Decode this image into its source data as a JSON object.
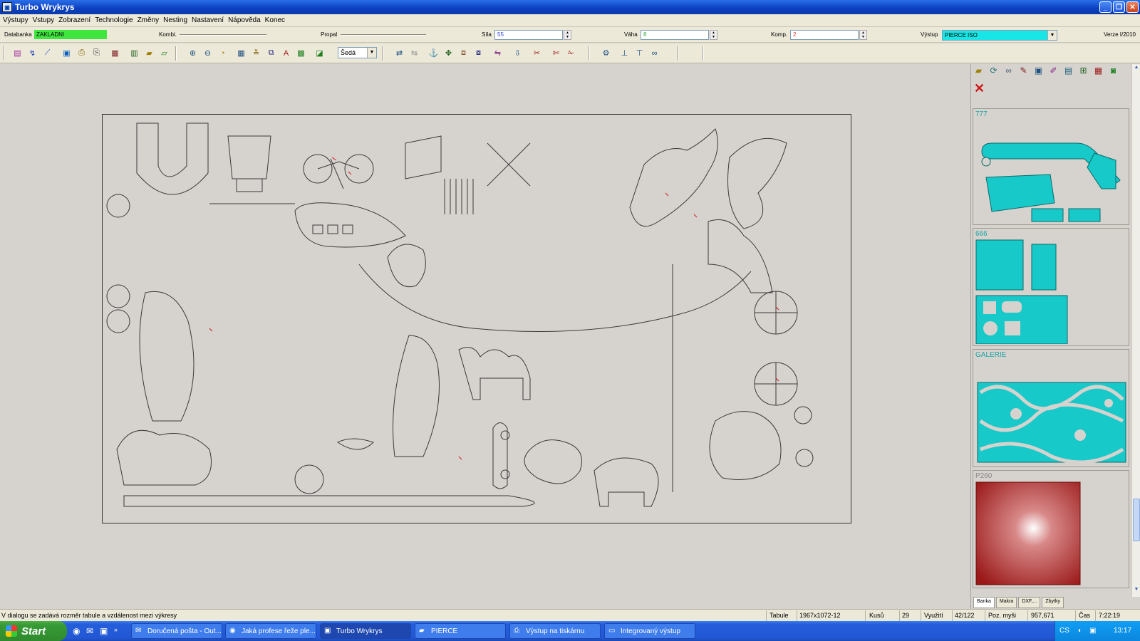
{
  "window": {
    "title": "Turbo Wrykrys"
  },
  "menu": [
    "Výstupy",
    "Vstupy",
    "Zobrazení",
    "Technologie",
    "Změny",
    "Nesting",
    "Nastavení",
    "Nápověda",
    "Konec"
  ],
  "params": {
    "databanka_label": "Databanka",
    "databanka_value": "ZAKLADNI",
    "kombi_label": "Kombi.",
    "propal_label": "Propal",
    "sila_label": "Síla",
    "sila_value": "55",
    "vaha_label": "Váha",
    "vaha_value": "8",
    "komp_label": "Komp.",
    "komp_value": "2",
    "vystup_label": "Výstup",
    "vystup_value": "PIERCE ISO",
    "verze": "Verze I/2010"
  },
  "toolbar": {
    "color_combo": "Šedá"
  },
  "panel": {
    "cards": [
      {
        "title": "777"
      },
      {
        "title": "666"
      },
      {
        "title": "GALERIE"
      },
      {
        "title": "P260"
      }
    ],
    "tabs": [
      "Banka",
      "Makra",
      "DXF,...",
      "Zbytky"
    ]
  },
  "status": {
    "hint": "V dialogu se zadává rozměr tabule a vzdálenost mezi výkresy",
    "tabule_label": "Tabule",
    "tabule_value": "1967x1072-12",
    "kusu_label": "Kusů",
    "kusu_value": "29",
    "vyuziti_label": "Využití",
    "vyuziti_value": "42/122",
    "pozmysi_label": "Poz. myši",
    "pozmysi_value": "957,671",
    "cas_label": "Čas",
    "cas_value": "7:22:19"
  },
  "taskbar": {
    "start": "Start",
    "tasks": [
      {
        "label": "Doručená pošta - Out..."
      },
      {
        "label": "Jaká profese řeže ple..."
      },
      {
        "label": "Turbo Wrykrys"
      },
      {
        "label": "PIERCE"
      },
      {
        "label": "Výstup na tiskárnu"
      },
      {
        "label": "Integrovaný výstup"
      }
    ],
    "lang": "CS",
    "clock": "13:17"
  },
  "colors": {
    "cyan": "#18c9c9",
    "green": "#3ee63e",
    "outline": "#3a3a3a",
    "pierce": "#d01818"
  }
}
